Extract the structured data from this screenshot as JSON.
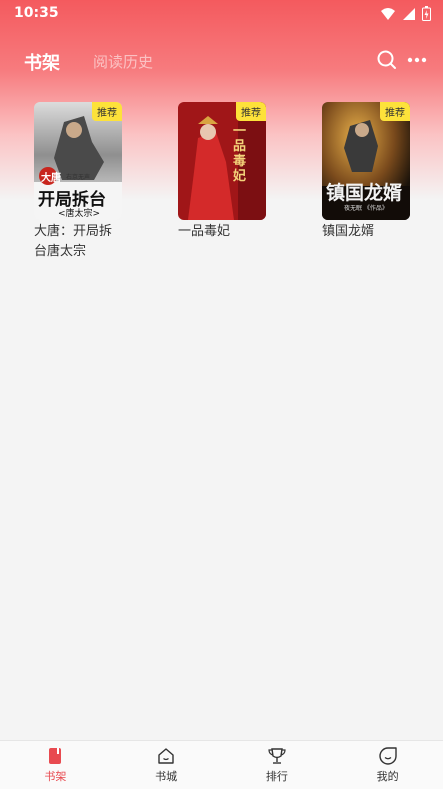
{
  "status_bar": {
    "time": "10:35"
  },
  "header": {
    "tabs": [
      {
        "label": "书架",
        "active": true
      },
      {
        "label": "阅读历史",
        "active": false
      }
    ]
  },
  "books": [
    {
      "title": "大唐：开局拆台唐太宗",
      "badge": "推荐",
      "cover_lines": [
        "大唐",
        "开局拆台",
        "<唐太宗>"
      ],
      "cover_author": "右京无声"
    },
    {
      "title": "一品毒妃",
      "badge": "推荐",
      "cover_lines": [
        "一品毒妃"
      ],
      "cover_author": ""
    },
    {
      "title": "镇国龙婿",
      "badge": "推荐",
      "cover_lines": [
        "镇国龙婿"
      ],
      "cover_author": "夜无眠 《作品》"
    }
  ],
  "bottom_nav": [
    {
      "label": "书架",
      "icon": "book-icon",
      "active": true
    },
    {
      "label": "书城",
      "icon": "store-icon",
      "active": false
    },
    {
      "label": "排行",
      "icon": "trophy-icon",
      "active": false
    },
    {
      "label": "我的",
      "icon": "profile-icon",
      "active": false
    }
  ],
  "colors": {
    "accent": "#e84a50",
    "badge": "#fde23a"
  }
}
